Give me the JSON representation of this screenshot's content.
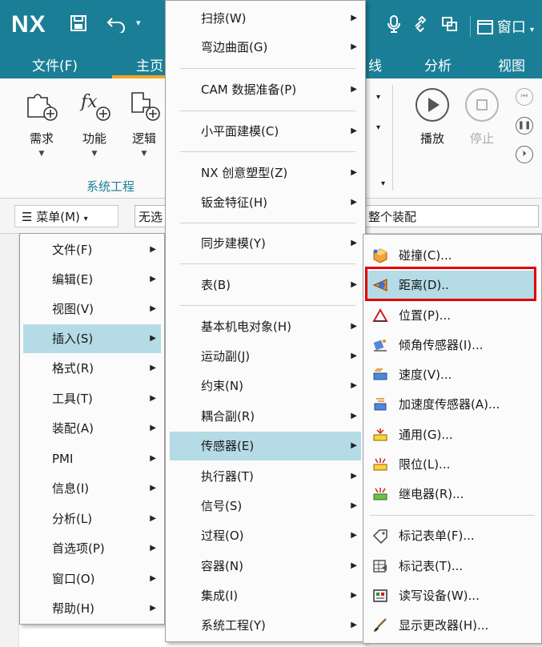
{
  "app": {
    "logo": "NX",
    "window_label": "窗口"
  },
  "tabs": [
    {
      "label": "文件(F)"
    },
    {
      "label": "主页"
    },
    {
      "label": "线"
    },
    {
      "label": "分析"
    },
    {
      "label": "视图"
    }
  ],
  "ribbon": {
    "buttons": [
      {
        "label": "需求",
        "icon": "requirement-puzzle-icon"
      },
      {
        "label": "功能",
        "icon": "function-fx-icon"
      },
      {
        "label": "逻辑",
        "icon": "logic-puzzle-icon"
      },
      {
        "label": "播放",
        "icon": "play-icon"
      },
      {
        "label": "停止",
        "icon": "stop-icon"
      }
    ],
    "group_label": "系统工程"
  },
  "command_bar": {
    "menu_label": "菜单(M)",
    "filter_text": "无选",
    "assembly_text": "整个装配"
  },
  "menu_main": [
    {
      "label": "文件(F)"
    },
    {
      "label": "编辑(E)"
    },
    {
      "label": "视图(V)"
    },
    {
      "label": "插入(S)",
      "highlighted": true
    },
    {
      "label": "格式(R)"
    },
    {
      "label": "工具(T)"
    },
    {
      "label": "装配(A)"
    },
    {
      "label": "PMI"
    },
    {
      "label": "信息(I)"
    },
    {
      "label": "分析(L)"
    },
    {
      "label": "首选项(P)"
    },
    {
      "label": "窗口(O)"
    },
    {
      "label": "帮助(H)"
    }
  ],
  "menu_insert": [
    {
      "label": "扫掠(W)"
    },
    {
      "label": "弯边曲面(G)"
    },
    {
      "label": "CAM 数据准备(P)"
    },
    {
      "label": "小平面建模(C)"
    },
    {
      "label": "NX 创意塑型(Z)"
    },
    {
      "label": "钣金特征(H)"
    },
    {
      "label": "同步建模(Y)"
    },
    {
      "label": "表(B)"
    },
    {
      "label": "基本机电对象(H)"
    },
    {
      "label": "运动副(J)"
    },
    {
      "label": "约束(N)"
    },
    {
      "label": "耦合副(R)"
    },
    {
      "label": "传感器(E)",
      "highlighted": true
    },
    {
      "label": "执行器(T)"
    },
    {
      "label": "信号(S)"
    },
    {
      "label": "过程(O)"
    },
    {
      "label": "容器(N)"
    },
    {
      "label": "集成(I)"
    },
    {
      "label": "系统工程(Y)"
    }
  ],
  "menu_sensor": [
    {
      "label": "碰撞(C)...",
      "icon": "collision-cube-icon"
    },
    {
      "label": "距离(D)..",
      "icon": "distance-sensor-icon",
      "highlighted": true
    },
    {
      "label": "位置(P)...",
      "icon": "position-triangle-icon"
    },
    {
      "label": "倾角传感器(I)...",
      "icon": "inclination-sensor-icon"
    },
    {
      "label": "速度(V)...",
      "icon": "speed-sensor-icon"
    },
    {
      "label": "加速度传感器(A)...",
      "icon": "acceleration-sensor-icon"
    },
    {
      "label": "通用(G)...",
      "icon": "generic-sensor-icon"
    },
    {
      "label": "限位(L)...",
      "icon": "limit-sensor-icon"
    },
    {
      "label": "继电器(R)...",
      "icon": "relay-icon"
    },
    {
      "label": "标记表单(F)...",
      "icon": "tag-form-icon"
    },
    {
      "label": "标记表(T)...",
      "icon": "tag-table-icon"
    },
    {
      "label": "读写设备(W)...",
      "icon": "read-write-device-icon"
    },
    {
      "label": "显示更改器(H)...",
      "icon": "display-changer-brush-icon"
    }
  ],
  "colors": {
    "ribbon_teal": "#1a7f96",
    "highlight": "#b4dbe6",
    "tab_accent": "#f5a623",
    "focus_frame": "#e00000"
  }
}
